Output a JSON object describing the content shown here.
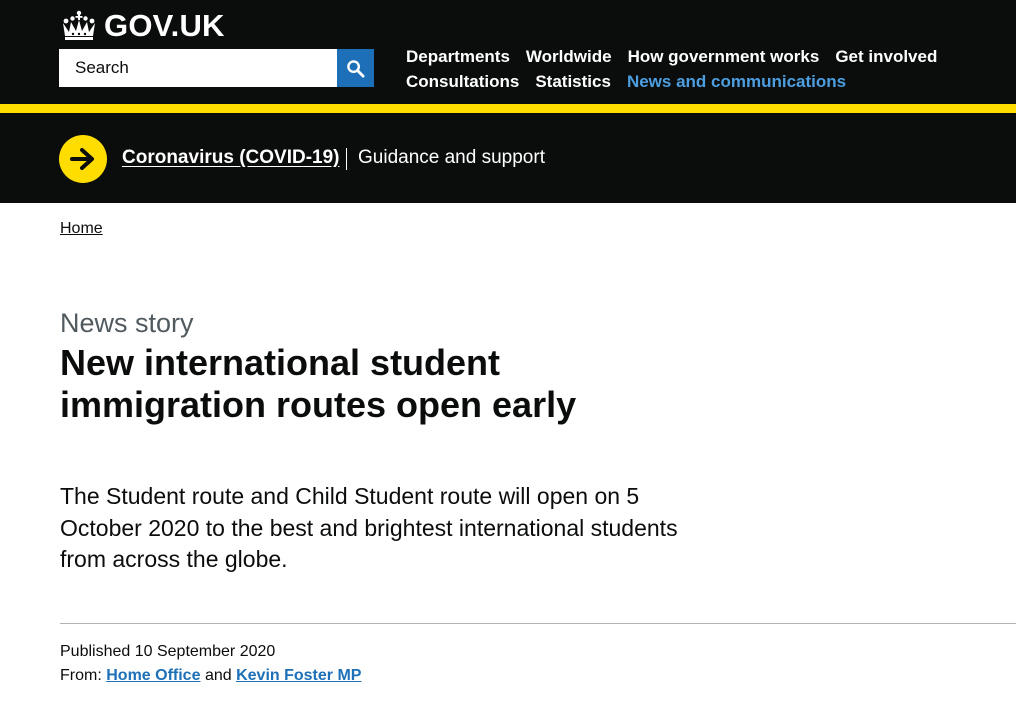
{
  "header": {
    "logo_text": "GOV.UK",
    "search": {
      "placeholder": "Search",
      "button_icon": "search-icon"
    },
    "nav": [
      {
        "label": "Departments",
        "active": false
      },
      {
        "label": "Worldwide",
        "active": false
      },
      {
        "label": "How government works",
        "active": false
      },
      {
        "label": "Get involved",
        "active": false
      },
      {
        "label": "Consultations",
        "active": false
      },
      {
        "label": "Statistics",
        "active": false
      },
      {
        "label": "News and communications",
        "active": true
      }
    ]
  },
  "covid_banner": {
    "link": "Coronavirus (COVID-19)",
    "description": "Guidance and support",
    "icon": "arrow-right-icon"
  },
  "breadcrumb": {
    "home": "Home"
  },
  "article": {
    "document_type": "News story",
    "title": "New international student immigration routes open early",
    "lead": "The Student route and Child Student route will open on 5 October 2020 to the best and brightest international students from across the globe.",
    "published_label": "Published",
    "published_date": "10 September 2020",
    "from_label": "From:",
    "from_org": "Home Office",
    "from_and": "and",
    "from_person": "Kevin Foster MP"
  },
  "colors": {
    "header_bg": "#0b0c0c",
    "accent_yellow": "#ffdd00",
    "link_blue": "#1d70b8",
    "active_nav": "#4c9ee0",
    "secondary_text": "#505a5f"
  }
}
